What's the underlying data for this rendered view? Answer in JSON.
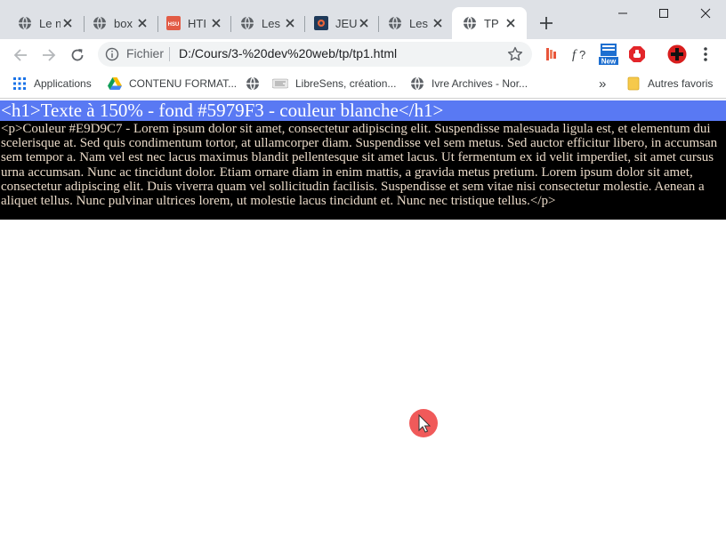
{
  "tabs": [
    {
      "title": "Le n",
      "favicon": "globe-icon"
    },
    {
      "title": "box",
      "favicon": "globe-icon"
    },
    {
      "title": "HTI",
      "favicon": "hsu-icon"
    },
    {
      "title": "Les",
      "favicon": "globe-icon"
    },
    {
      "title": "JEU",
      "favicon": "oc-icon"
    },
    {
      "title": "Les",
      "favicon": "globe-icon"
    },
    {
      "title": "TP",
      "favicon": "globe-icon",
      "active": true
    }
  ],
  "tab_favicon_hsu": "HSU",
  "address": {
    "scheme_label": "Fichier",
    "url": "D:/Cours/3-%20dev%20web/tp/tp1.html"
  },
  "bookmarks": {
    "items": [
      {
        "label": "Applications",
        "icon": "apps-grid-icon"
      },
      {
        "label": "CONTENU FORMAT...",
        "icon": "drive-icon"
      },
      {
        "label": "",
        "icon": "globe-icon"
      },
      {
        "label": "LibreSens, création...",
        "icon": "libresens-icon"
      },
      {
        "label": "Ivre Archives - Nor...",
        "icon": "globe-icon"
      }
    ],
    "overflow": "»",
    "other_label": "Autres favoris"
  },
  "extensions": {
    "new_badge": "New"
  },
  "page": {
    "h1_text": "<h1>Texte à 150% - fond #5979F3 - couleur blanche</h1>",
    "p_text": "<p>Couleur #E9D9C7 - Lorem ipsum dolor sit amet, consectetur adipiscing elit. Suspendisse malesuada ligula est, et elementum dui scelerisque at. Sed quis condimentum tortor, at ullamcorper diam. Suspendisse vel sem metus. Sed auctor efficitur libero, in accumsan sem tempor a. Nam vel est nec lacus maximus blandit pellentesque sit amet lacus. Ut fermentum ex id velit imperdiet, sit amet cursus urna accumsan. Nunc ac tincidunt dolor. Etiam ornare diam in enim mattis, a gravida metus pretium. Lorem ipsum dolor sit amet, consectetur adipiscing elit. Duis viverra quam vel sollicitudin facilisis. Suspendisse et sem vitae nisi consectetur molestie. Aenean a aliquet tellus. Nunc pulvinar ultrices lorem, ut molestie lacus tincidunt et. Nunc nec tristique tellus.</p>"
  },
  "colors": {
    "h1_background": "#5979F3",
    "h1_text": "#FFFFFF",
    "p_background": "#000000",
    "p_text": "#E9D9C7",
    "cursor_highlight": "#F05A5A"
  }
}
